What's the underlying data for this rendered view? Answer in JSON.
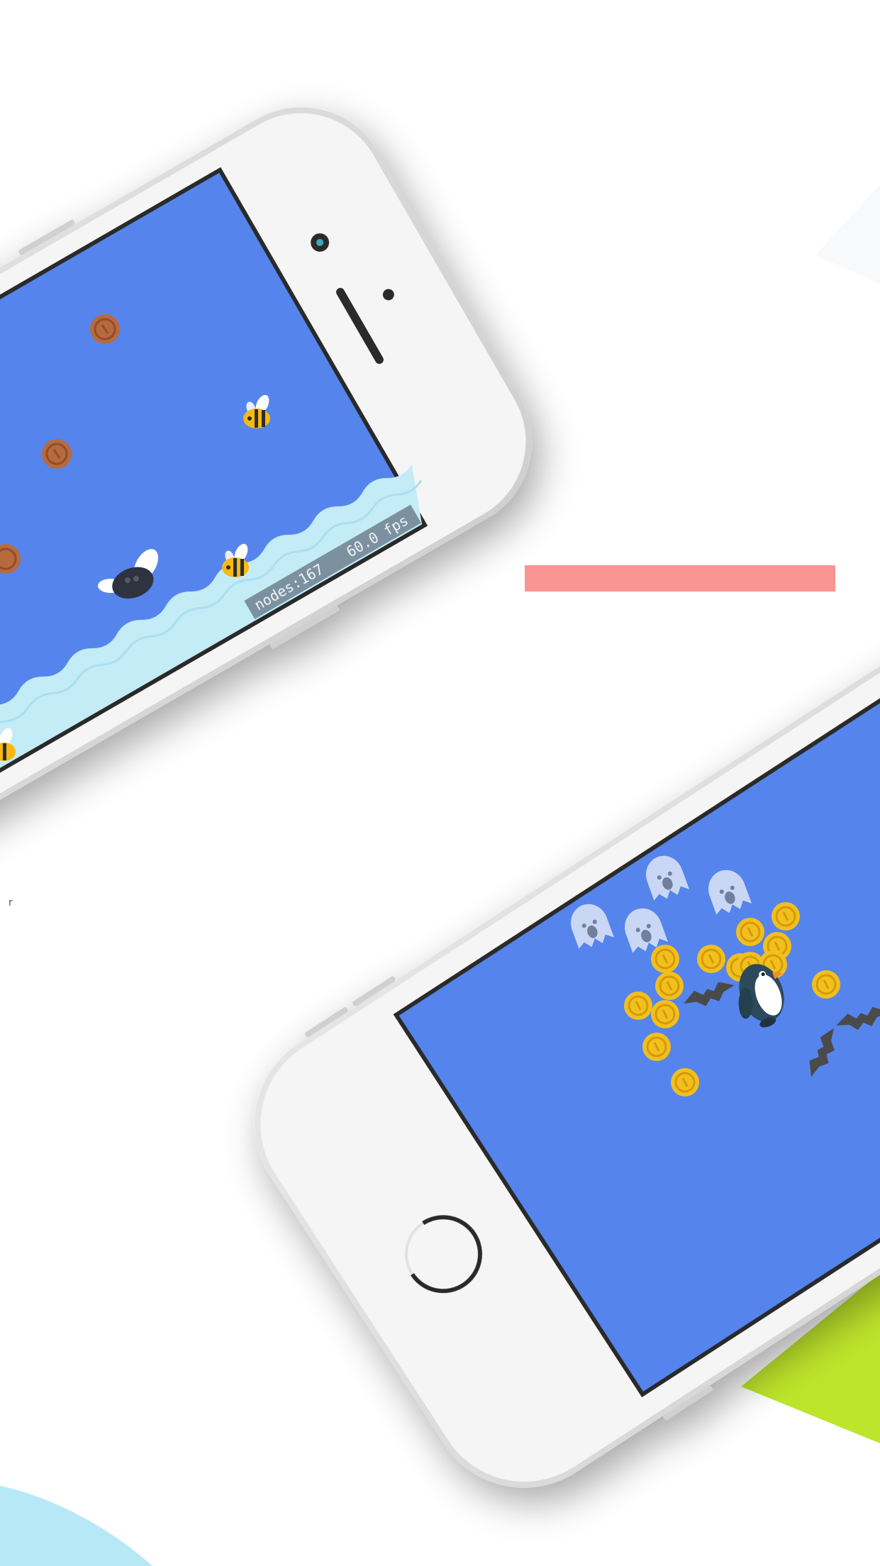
{
  "colors": {
    "background": "#ffffff",
    "screen": "#5585ec",
    "phone_body": "#f5f5f5",
    "phone_rim": "#dddddd",
    "screen_bezel": "#2b2b2b",
    "coral_bar": "#f99593",
    "lime_shape": "#bde52b",
    "sky_shape": "#b6e8f6",
    "water": "#c4ecf6",
    "copper_coin": "#b86a3e",
    "gold_coin": "#f3bf1c",
    "ghost": "#c9d6f4",
    "bee_yellow": "#f8b912",
    "penguin": "#2c4a5b",
    "bat": "#4a4a4a"
  },
  "phone_top": {
    "debug_stats": {
      "nodes_label": "nodes:167",
      "fps_label": "60.0 fps"
    },
    "sprites": {
      "copper_coins": [
        "copper-coin",
        "copper-coin",
        "copper-coin"
      ],
      "bees": [
        "bee",
        "bee",
        "bee"
      ],
      "fly": "fly-creature"
    }
  },
  "phone_bottom": {
    "sprites": {
      "ghosts": [
        "ghost",
        "ghost",
        "ghost",
        "ghost"
      ],
      "gold_coins": 14,
      "penguin": "penguin",
      "bats": [
        "bat",
        "bat",
        "bat"
      ]
    }
  }
}
